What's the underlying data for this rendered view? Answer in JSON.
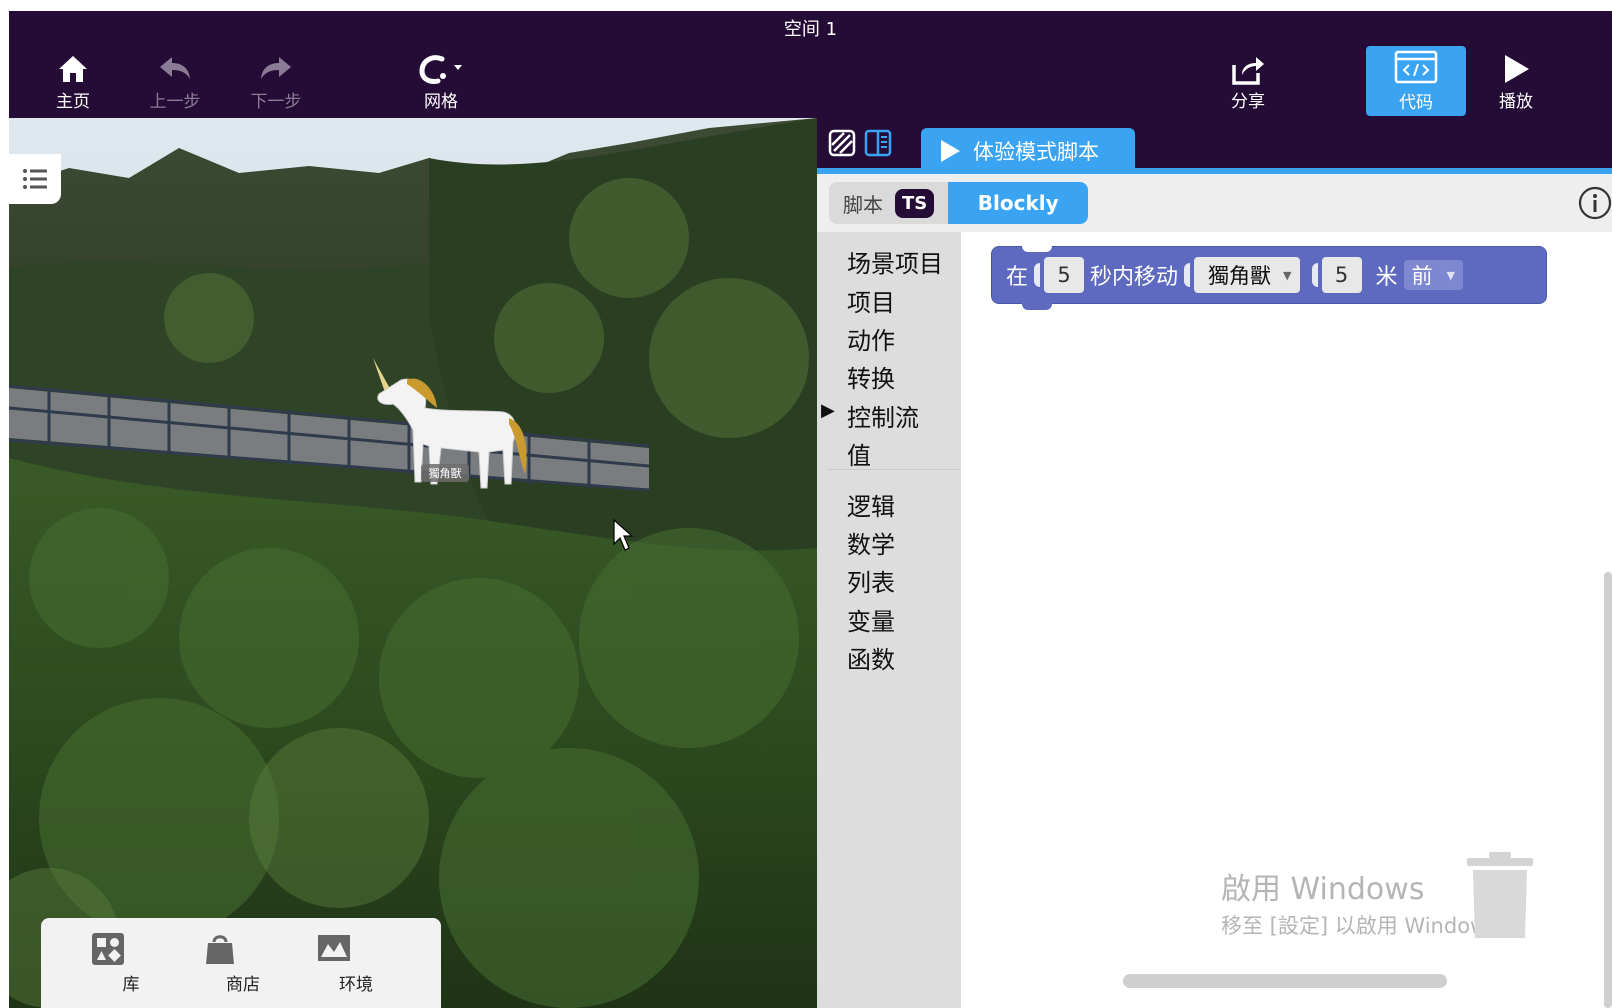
{
  "window": {
    "title": "空间 1"
  },
  "toolbar": {
    "home_label": "主页",
    "undo_label": "上一步",
    "redo_label": "下一步",
    "grid_label": "网格",
    "share_label": "分享",
    "code_label": "代码",
    "play_label": "播放"
  },
  "scene": {
    "object_label": "獨角獸",
    "dock": {
      "library_label": "库",
      "shop_label": "商店",
      "environment_label": "环境"
    }
  },
  "editor": {
    "script_tab_label": "体验模式脚本",
    "modes": {
      "javascript_label": "脚本",
      "ts_badge": "TS",
      "blockly_label": "Blockly"
    },
    "toolbox": {
      "categories": [
        "场景项目",
        "项目",
        "动作",
        "转换",
        "控制流",
        "值"
      ],
      "categories_2": [
        "逻辑",
        "数学",
        "列表",
        "变量",
        "函数"
      ],
      "selected": "控制流"
    },
    "block": {
      "text_in": "在",
      "seconds_value": "5",
      "text_move": "秒内移动",
      "target": "獨角獸",
      "distance_value": "5",
      "text_meters": "米",
      "direction": "前",
      "color": "#5e6ac0"
    }
  },
  "watermark": {
    "line1": "啟用 Windows",
    "line2": "移至 [設定] 以啟用 Windows。"
  },
  "colors": {
    "topbar": "#250c36",
    "accent": "#3aa4f2",
    "toolbox": "#dddddd"
  }
}
